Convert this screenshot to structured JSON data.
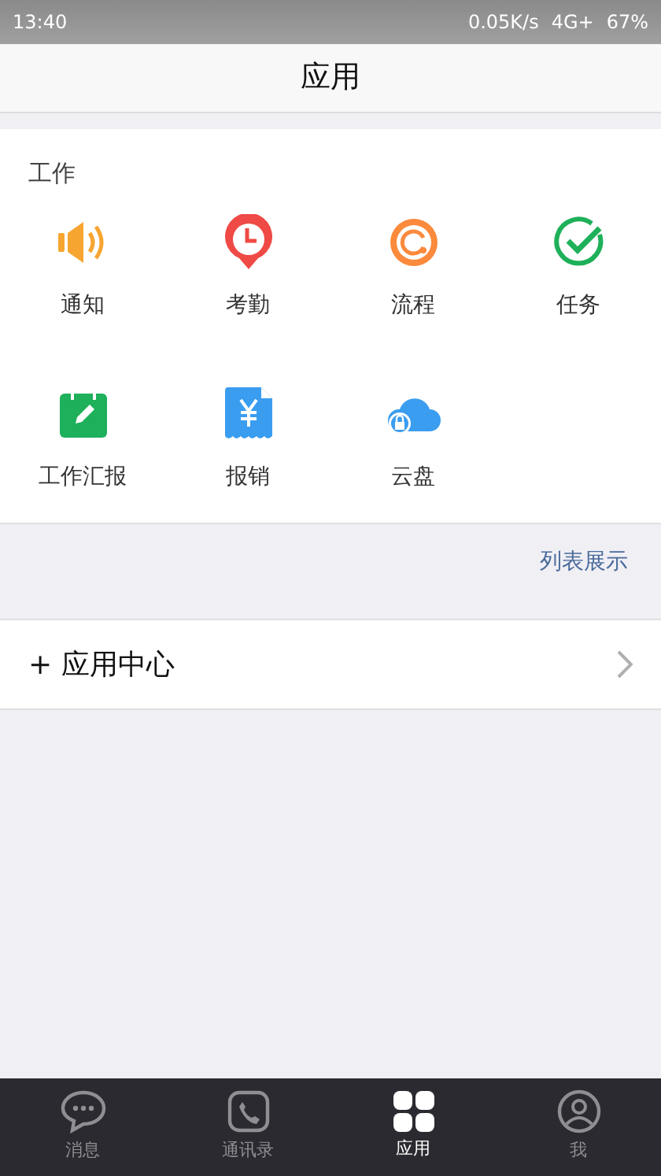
{
  "status_bar": {
    "time": "13:40",
    "speed": "0.05K/s",
    "network": "4G+",
    "battery": "67%"
  },
  "header": {
    "title": "应用"
  },
  "section": {
    "title": "工作",
    "apps": [
      {
        "label": "通知",
        "kind": "speaker"
      },
      {
        "label": "考勤",
        "kind": "pin-clock"
      },
      {
        "label": "流程",
        "kind": "ring"
      },
      {
        "label": "任务",
        "kind": "check"
      },
      {
        "label": "工作汇报",
        "kind": "notepad"
      },
      {
        "label": "报销",
        "kind": "receipt"
      },
      {
        "label": "云盘",
        "kind": "cloud"
      }
    ]
  },
  "list_view_link": "列表展示",
  "app_center": {
    "label": "+ 应用中心"
  },
  "tabs": [
    {
      "label": "消息",
      "kind": "chat",
      "selected": false
    },
    {
      "label": "通讯录",
      "kind": "phone",
      "selected": false
    },
    {
      "label": "应用",
      "kind": "grid",
      "selected": true
    },
    {
      "label": "我",
      "kind": "user",
      "selected": false
    }
  ]
}
